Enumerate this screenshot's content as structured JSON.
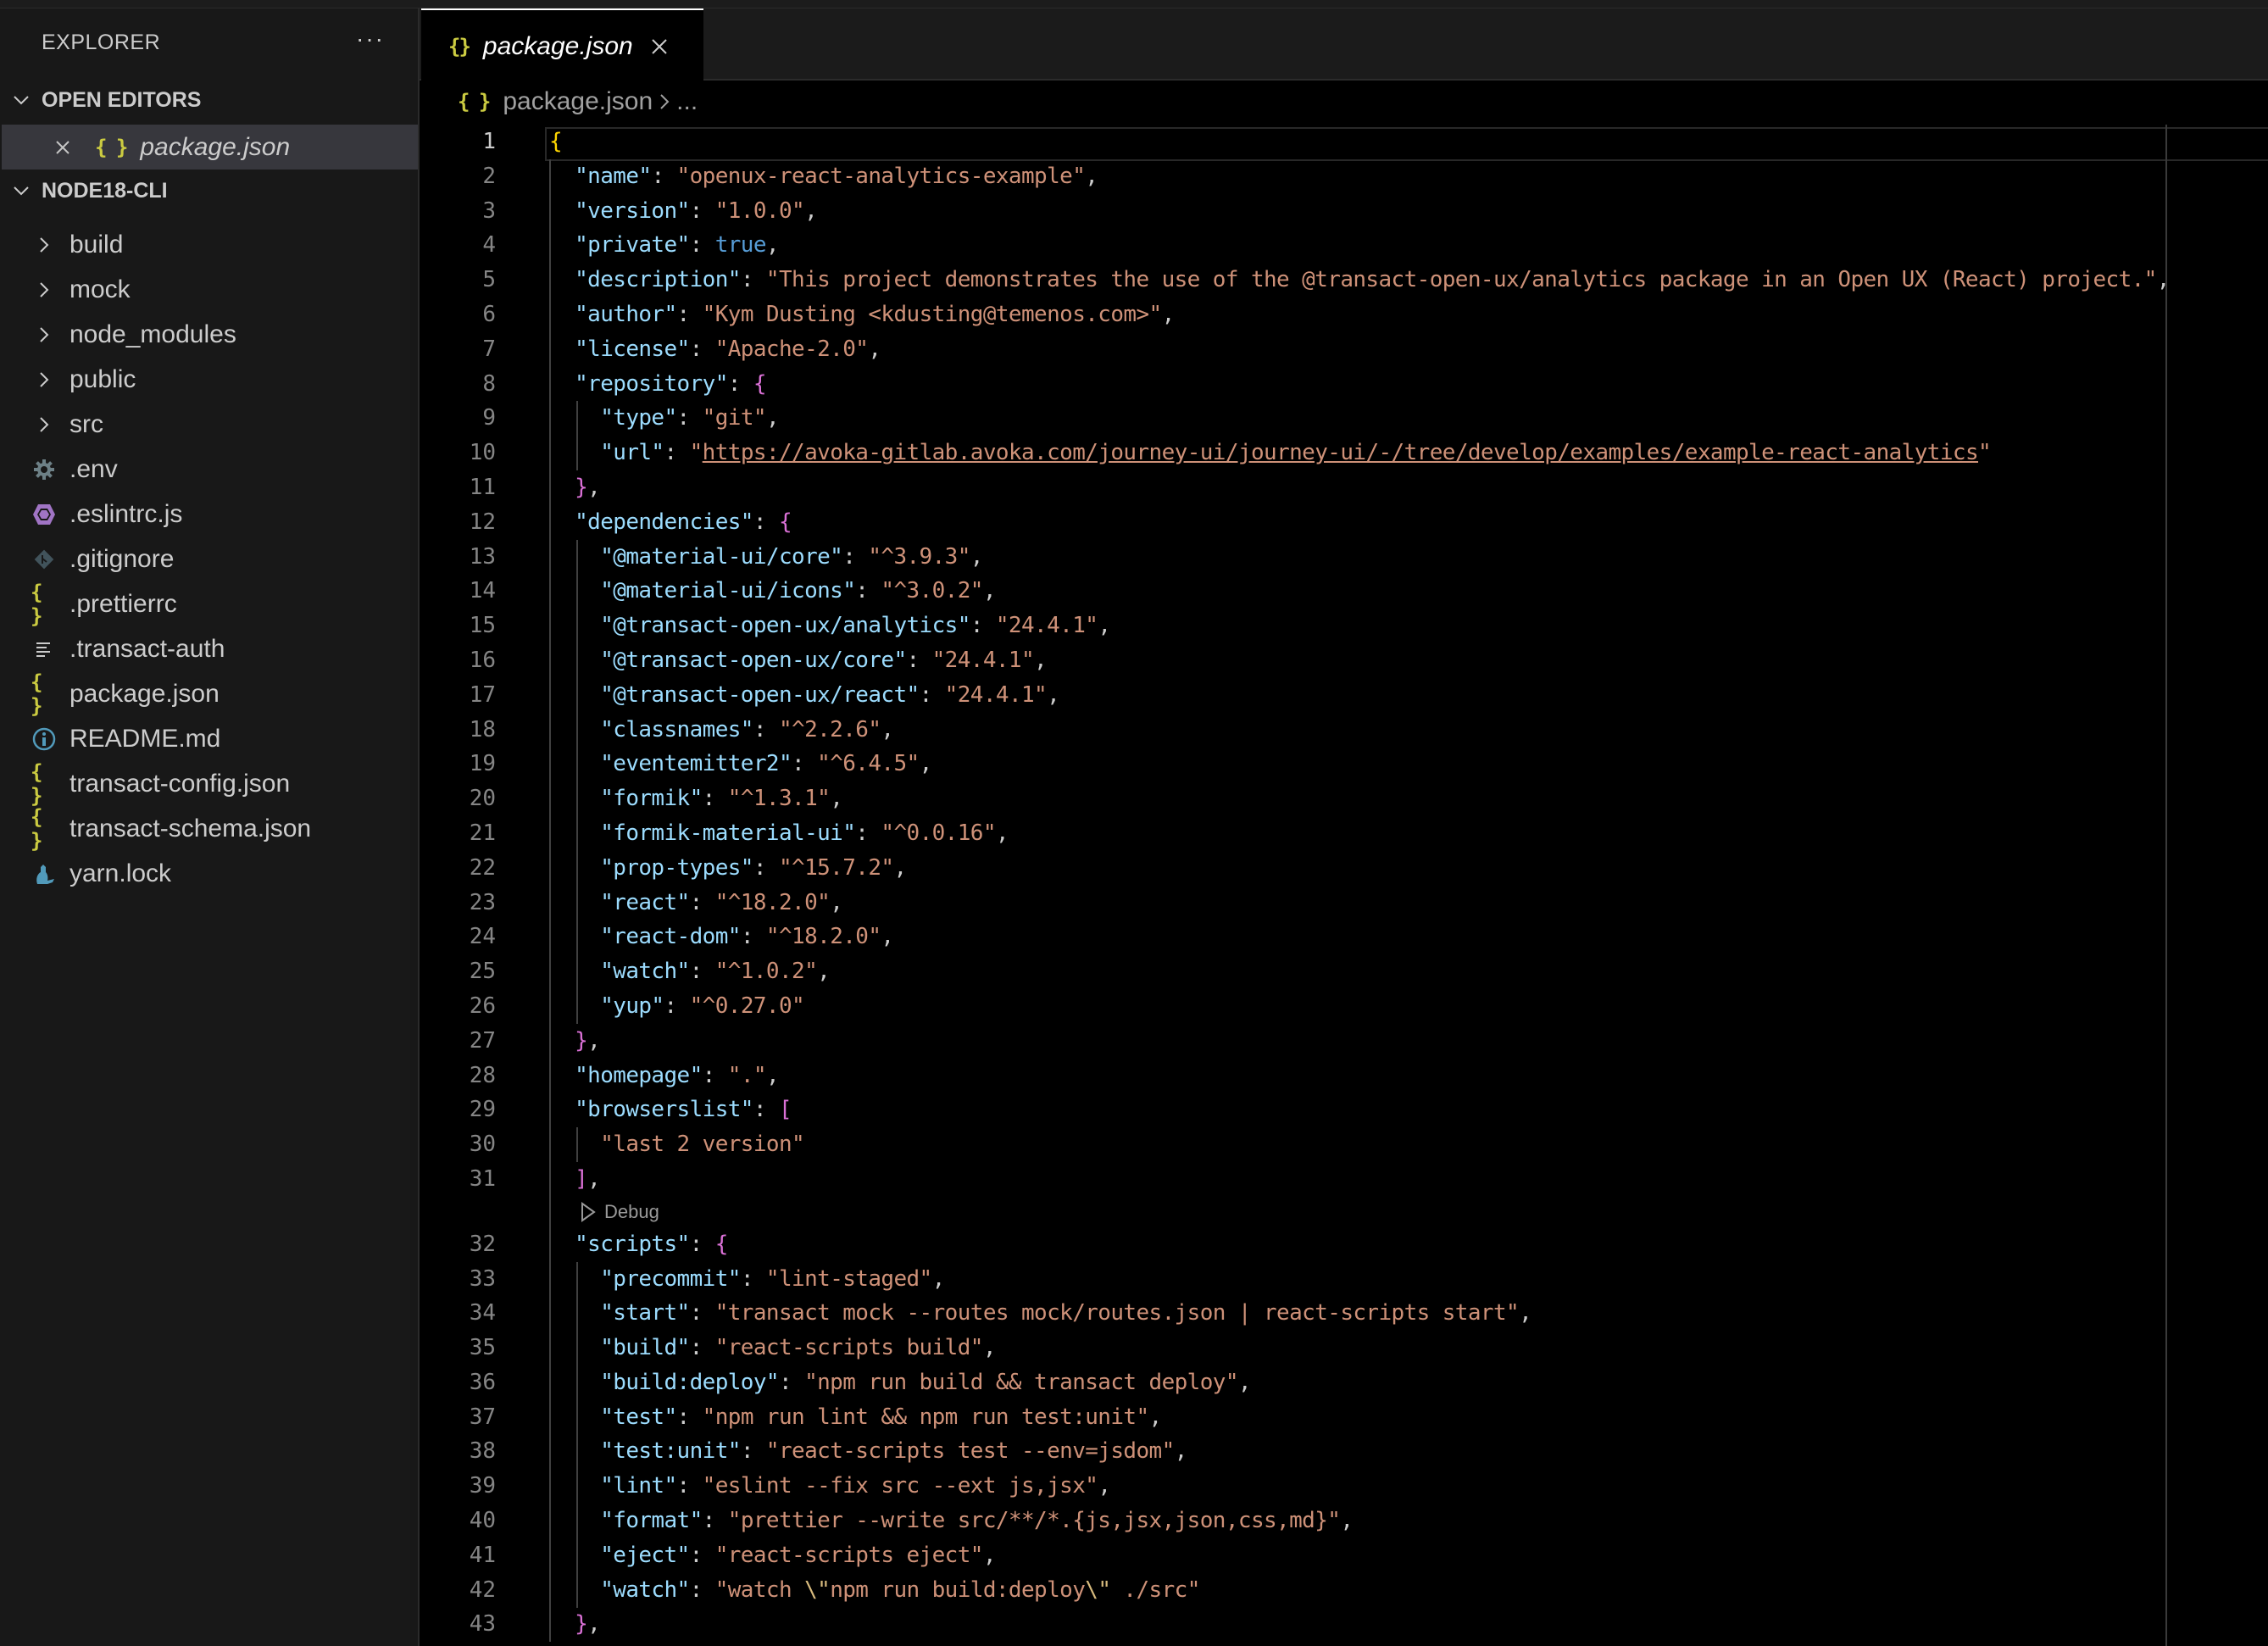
{
  "sidebar": {
    "title": "EXPLORER",
    "more_label": "···",
    "open_editors_label": "OPEN EDITORS",
    "open_editor_file": "package.json",
    "workspace_label": "NODE18-CLI",
    "tree": [
      {
        "name": "build",
        "type": "folder",
        "icon": "chevron-right-icon"
      },
      {
        "name": "mock",
        "type": "folder",
        "icon": "chevron-right-icon"
      },
      {
        "name": "node_modules",
        "type": "folder",
        "icon": "chevron-right-icon"
      },
      {
        "name": "public",
        "type": "folder",
        "icon": "chevron-right-icon"
      },
      {
        "name": "src",
        "type": "folder",
        "icon": "chevron-right-icon"
      },
      {
        "name": ".env",
        "type": "file",
        "icon": "gear-icon"
      },
      {
        "name": ".eslintrc.js",
        "type": "file",
        "icon": "eslint-icon"
      },
      {
        "name": ".gitignore",
        "type": "file",
        "icon": "git-icon"
      },
      {
        "name": ".prettierrc",
        "type": "file",
        "icon": "json-braces-icon"
      },
      {
        "name": ".transact-auth",
        "type": "file",
        "icon": "text-lines-icon"
      },
      {
        "name": "package.json",
        "type": "file",
        "icon": "json-braces-icon"
      },
      {
        "name": "README.md",
        "type": "file",
        "icon": "info-icon"
      },
      {
        "name": "transact-config.json",
        "type": "file",
        "icon": "json-braces-icon"
      },
      {
        "name": "transact-schema.json",
        "type": "file",
        "icon": "json-braces-icon"
      },
      {
        "name": "yarn.lock",
        "type": "file",
        "icon": "yarn-icon"
      }
    ]
  },
  "tab": {
    "label": "package.json"
  },
  "breadcrumb": {
    "file": "package.json",
    "tail": "..."
  },
  "codelens": {
    "label": "Debug",
    "after_line": 31
  },
  "colors": {
    "key": "#9cdcfe",
    "string": "#ce9178",
    "boolean": "#569cd6",
    "bracket_level1": "#ffd700",
    "bracket_level2": "#da70d6",
    "json_icon": "#cbcb41",
    "sidebar_bg": "#181818",
    "selected_row_bg": "#37373d"
  },
  "code_lines": [
    {
      "n": 1,
      "tokens": [
        [
          "br1",
          "{"
        ]
      ]
    },
    {
      "n": 2,
      "tokens": [
        [
          "p",
          "  "
        ],
        [
          "k",
          "\"name\""
        ],
        [
          "p",
          ": "
        ],
        [
          "s",
          "\"openux-react-analytics-example\""
        ],
        [
          "p",
          ","
        ]
      ]
    },
    {
      "n": 3,
      "tokens": [
        [
          "p",
          "  "
        ],
        [
          "k",
          "\"version\""
        ],
        [
          "p",
          ": "
        ],
        [
          "s",
          "\"1.0.0\""
        ],
        [
          "p",
          ","
        ]
      ]
    },
    {
      "n": 4,
      "tokens": [
        [
          "p",
          "  "
        ],
        [
          "k",
          "\"private\""
        ],
        [
          "p",
          ": "
        ],
        [
          "b",
          "true"
        ],
        [
          "p",
          ","
        ]
      ]
    },
    {
      "n": 5,
      "tokens": [
        [
          "p",
          "  "
        ],
        [
          "k",
          "\"description\""
        ],
        [
          "p",
          ": "
        ],
        [
          "s",
          "\"This project demonstrates the use of the @transact-open-ux/analytics package in an Open UX (React) project.\""
        ],
        [
          "p",
          ","
        ]
      ]
    },
    {
      "n": 6,
      "tokens": [
        [
          "p",
          "  "
        ],
        [
          "k",
          "\"author\""
        ],
        [
          "p",
          ": "
        ],
        [
          "s",
          "\"Kym Dusting <kdusting@temenos.com>\""
        ],
        [
          "p",
          ","
        ]
      ]
    },
    {
      "n": 7,
      "tokens": [
        [
          "p",
          "  "
        ],
        [
          "k",
          "\"license\""
        ],
        [
          "p",
          ": "
        ],
        [
          "s",
          "\"Apache-2.0\""
        ],
        [
          "p",
          ","
        ]
      ]
    },
    {
      "n": 8,
      "tokens": [
        [
          "p",
          "  "
        ],
        [
          "k",
          "\"repository\""
        ],
        [
          "p",
          ": "
        ],
        [
          "br2",
          "{"
        ]
      ]
    },
    {
      "n": 9,
      "tokens": [
        [
          "p",
          "    "
        ],
        [
          "k",
          "\"type\""
        ],
        [
          "p",
          ": "
        ],
        [
          "s",
          "\"git\""
        ],
        [
          "p",
          ","
        ]
      ]
    },
    {
      "n": 10,
      "tokens": [
        [
          "p",
          "    "
        ],
        [
          "k",
          "\"url\""
        ],
        [
          "p",
          ": "
        ],
        [
          "s",
          "\""
        ],
        [
          "s u",
          "https://avoka-gitlab.avoka.com/journey-ui/journey-ui/-/tree/develop/examples/example-react-analytics"
        ],
        [
          "s",
          "\""
        ]
      ]
    },
    {
      "n": 11,
      "tokens": [
        [
          "p",
          "  "
        ],
        [
          "br2",
          "}"
        ],
        [
          "p",
          ","
        ]
      ]
    },
    {
      "n": 12,
      "tokens": [
        [
          "p",
          "  "
        ],
        [
          "k",
          "\"dependencies\""
        ],
        [
          "p",
          ": "
        ],
        [
          "br2",
          "{"
        ]
      ]
    },
    {
      "n": 13,
      "tokens": [
        [
          "p",
          "    "
        ],
        [
          "k",
          "\"@material-ui/core\""
        ],
        [
          "p",
          ": "
        ],
        [
          "s",
          "\"^3.9.3\""
        ],
        [
          "p",
          ","
        ]
      ]
    },
    {
      "n": 14,
      "tokens": [
        [
          "p",
          "    "
        ],
        [
          "k",
          "\"@material-ui/icons\""
        ],
        [
          "p",
          ": "
        ],
        [
          "s",
          "\"^3.0.2\""
        ],
        [
          "p",
          ","
        ]
      ]
    },
    {
      "n": 15,
      "tokens": [
        [
          "p",
          "    "
        ],
        [
          "k",
          "\"@transact-open-ux/analytics\""
        ],
        [
          "p",
          ": "
        ],
        [
          "s",
          "\"24.4.1\""
        ],
        [
          "p",
          ","
        ]
      ]
    },
    {
      "n": 16,
      "tokens": [
        [
          "p",
          "    "
        ],
        [
          "k",
          "\"@transact-open-ux/core\""
        ],
        [
          "p",
          ": "
        ],
        [
          "s",
          "\"24.4.1\""
        ],
        [
          "p",
          ","
        ]
      ]
    },
    {
      "n": 17,
      "tokens": [
        [
          "p",
          "    "
        ],
        [
          "k",
          "\"@transact-open-ux/react\""
        ],
        [
          "p",
          ": "
        ],
        [
          "s",
          "\"24.4.1\""
        ],
        [
          "p",
          ","
        ]
      ]
    },
    {
      "n": 18,
      "tokens": [
        [
          "p",
          "    "
        ],
        [
          "k",
          "\"classnames\""
        ],
        [
          "p",
          ": "
        ],
        [
          "s",
          "\"^2.2.6\""
        ],
        [
          "p",
          ","
        ]
      ]
    },
    {
      "n": 19,
      "tokens": [
        [
          "p",
          "    "
        ],
        [
          "k",
          "\"eventemitter2\""
        ],
        [
          "p",
          ": "
        ],
        [
          "s",
          "\"^6.4.5\""
        ],
        [
          "p",
          ","
        ]
      ]
    },
    {
      "n": 20,
      "tokens": [
        [
          "p",
          "    "
        ],
        [
          "k",
          "\"formik\""
        ],
        [
          "p",
          ": "
        ],
        [
          "s",
          "\"^1.3.1\""
        ],
        [
          "p",
          ","
        ]
      ]
    },
    {
      "n": 21,
      "tokens": [
        [
          "p",
          "    "
        ],
        [
          "k",
          "\"formik-material-ui\""
        ],
        [
          "p",
          ": "
        ],
        [
          "s",
          "\"^0.0.16\""
        ],
        [
          "p",
          ","
        ]
      ]
    },
    {
      "n": 22,
      "tokens": [
        [
          "p",
          "    "
        ],
        [
          "k",
          "\"prop-types\""
        ],
        [
          "p",
          ": "
        ],
        [
          "s",
          "\"^15.7.2\""
        ],
        [
          "p",
          ","
        ]
      ]
    },
    {
      "n": 23,
      "tokens": [
        [
          "p",
          "    "
        ],
        [
          "k",
          "\"react\""
        ],
        [
          "p",
          ": "
        ],
        [
          "s",
          "\"^18.2.0\""
        ],
        [
          "p",
          ","
        ]
      ]
    },
    {
      "n": 24,
      "tokens": [
        [
          "p",
          "    "
        ],
        [
          "k",
          "\"react-dom\""
        ],
        [
          "p",
          ": "
        ],
        [
          "s",
          "\"^18.2.0\""
        ],
        [
          "p",
          ","
        ]
      ]
    },
    {
      "n": 25,
      "tokens": [
        [
          "p",
          "    "
        ],
        [
          "k",
          "\"watch\""
        ],
        [
          "p",
          ": "
        ],
        [
          "s",
          "\"^1.0.2\""
        ],
        [
          "p",
          ","
        ]
      ]
    },
    {
      "n": 26,
      "tokens": [
        [
          "p",
          "    "
        ],
        [
          "k",
          "\"yup\""
        ],
        [
          "p",
          ": "
        ],
        [
          "s",
          "\"^0.27.0\""
        ]
      ]
    },
    {
      "n": 27,
      "tokens": [
        [
          "p",
          "  "
        ],
        [
          "br2",
          "}"
        ],
        [
          "p",
          ","
        ]
      ]
    },
    {
      "n": 28,
      "tokens": [
        [
          "p",
          "  "
        ],
        [
          "k",
          "\"homepage\""
        ],
        [
          "p",
          ": "
        ],
        [
          "s",
          "\".\""
        ],
        [
          "p",
          ","
        ]
      ]
    },
    {
      "n": 29,
      "tokens": [
        [
          "p",
          "  "
        ],
        [
          "k",
          "\"browserslist\""
        ],
        [
          "p",
          ": "
        ],
        [
          "br2",
          "["
        ]
      ]
    },
    {
      "n": 30,
      "tokens": [
        [
          "p",
          "    "
        ],
        [
          "s",
          "\"last 2 version\""
        ]
      ]
    },
    {
      "n": 31,
      "tokens": [
        [
          "p",
          "  "
        ],
        [
          "br2",
          "]"
        ],
        [
          "p",
          ","
        ]
      ]
    },
    {
      "n": 32,
      "tokens": [
        [
          "p",
          "  "
        ],
        [
          "k",
          "\"scripts\""
        ],
        [
          "p",
          ": "
        ],
        [
          "br2",
          "{"
        ]
      ]
    },
    {
      "n": 33,
      "tokens": [
        [
          "p",
          "    "
        ],
        [
          "k",
          "\"precommit\""
        ],
        [
          "p",
          ": "
        ],
        [
          "s",
          "\"lint-staged\""
        ],
        [
          "p",
          ","
        ]
      ]
    },
    {
      "n": 34,
      "tokens": [
        [
          "p",
          "    "
        ],
        [
          "k",
          "\"start\""
        ],
        [
          "p",
          ": "
        ],
        [
          "s",
          "\"transact mock --routes mock/routes.json | react-scripts start\""
        ],
        [
          "p",
          ","
        ]
      ]
    },
    {
      "n": 35,
      "tokens": [
        [
          "p",
          "    "
        ],
        [
          "k",
          "\"build\""
        ],
        [
          "p",
          ": "
        ],
        [
          "s",
          "\"react-scripts build\""
        ],
        [
          "p",
          ","
        ]
      ]
    },
    {
      "n": 36,
      "tokens": [
        [
          "p",
          "    "
        ],
        [
          "k",
          "\"build:deploy\""
        ],
        [
          "p",
          ": "
        ],
        [
          "s",
          "\"npm run build && transact deploy\""
        ],
        [
          "p",
          ","
        ]
      ]
    },
    {
      "n": 37,
      "tokens": [
        [
          "p",
          "    "
        ],
        [
          "k",
          "\"test\""
        ],
        [
          "p",
          ": "
        ],
        [
          "s",
          "\"npm run lint && npm run test:unit\""
        ],
        [
          "p",
          ","
        ]
      ]
    },
    {
      "n": 38,
      "tokens": [
        [
          "p",
          "    "
        ],
        [
          "k",
          "\"test:unit\""
        ],
        [
          "p",
          ": "
        ],
        [
          "s",
          "\"react-scripts test --env=jsdom\""
        ],
        [
          "p",
          ","
        ]
      ]
    },
    {
      "n": 39,
      "tokens": [
        [
          "p",
          "    "
        ],
        [
          "k",
          "\"lint\""
        ],
        [
          "p",
          ": "
        ],
        [
          "s",
          "\"eslint --fix src --ext js,jsx\""
        ],
        [
          "p",
          ","
        ]
      ]
    },
    {
      "n": 40,
      "tokens": [
        [
          "p",
          "    "
        ],
        [
          "k",
          "\"format\""
        ],
        [
          "p",
          ": "
        ],
        [
          "s",
          "\"prettier --write src/**/*.{js,jsx,json,css,md}\""
        ],
        [
          "p",
          ","
        ]
      ]
    },
    {
      "n": 41,
      "tokens": [
        [
          "p",
          "    "
        ],
        [
          "k",
          "\"eject\""
        ],
        [
          "p",
          ": "
        ],
        [
          "s",
          "\"react-scripts eject\""
        ],
        [
          "p",
          ","
        ]
      ]
    },
    {
      "n": 42,
      "tokens": [
        [
          "p",
          "    "
        ],
        [
          "k",
          "\"watch\""
        ],
        [
          "p",
          ": "
        ],
        [
          "s",
          "\"watch "
        ],
        [
          "esc",
          "\\\""
        ],
        [
          "s",
          "npm run build:deploy"
        ],
        [
          "esc",
          "\\\""
        ],
        [
          "s",
          " ./src\""
        ]
      ]
    },
    {
      "n": 43,
      "tokens": [
        [
          "p",
          "  "
        ],
        [
          "br2",
          "}"
        ],
        [
          "p",
          ","
        ]
      ]
    }
  ],
  "active_line": 1
}
